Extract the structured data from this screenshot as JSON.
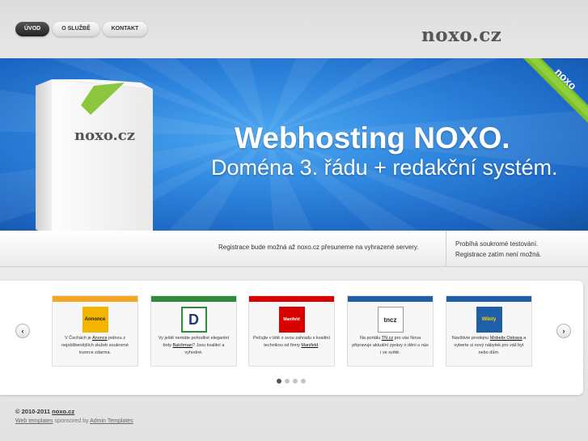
{
  "nav": {
    "items": [
      {
        "label": "ÚVOD",
        "active": true
      },
      {
        "label": "O SLUŽBĚ",
        "active": false
      },
      {
        "label": "KONTAKT",
        "active": false
      }
    ]
  },
  "logo": {
    "text": "noxo.cz"
  },
  "banner": {
    "headline": "Webhosting NOXO.",
    "subline": "Doména 3. řádu + redakční systém.",
    "box_label": "noxo.cz",
    "box_badge": "NOXO",
    "corner_badge": "noxo"
  },
  "info": {
    "left": "Registrace bude možná až noxo.cz přesuneme na vyhrazené servery.",
    "right_line1": "Probíhá soukromé testování.",
    "right_line2": "Registrace zatím není možná."
  },
  "carousel": {
    "prev_label": "‹",
    "next_label": "›",
    "cards": [
      {
        "color": "#f5a623",
        "thumb_label": "Annonce",
        "pre": "V Čechách je ",
        "link": "Anonce",
        "post": " jednou z nejoblíbenějších služeb soukromé inzerce zdarma."
      },
      {
        "color": "#2e8b3a",
        "thumb_label": "D",
        "pre": "Vy ještě nemáte pohodlné elegantní boty ",
        "link": "Balchman",
        "post": "? Jsou kvalitní a vyhodné."
      },
      {
        "color": "#d90000",
        "thumb_label": "Manifeld",
        "pre": "Pečujte v létě o svou zahradu s kvalitní technikou od firmy ",
        "link": "Manifeld",
        "post": "."
      },
      {
        "color": "#1e5fa8",
        "thumb_label": "tncz",
        "pre": "Na portálu ",
        "link": "TN.cz",
        "post": " pro vás Nova připravuje aktuální zprávy o dění u nás i ve světě."
      },
      {
        "color": "#1e5fa8",
        "thumb_label": "Wikity",
        "pre": "Navštivte prodejnu ",
        "link": "Mobelix Ostrava",
        "post": " a vyberte si nový nábytek pro váš byt nebo dům."
      }
    ],
    "dots": 4,
    "active_dot": 0
  },
  "footer": {
    "copyright": "© 2010-2011",
    "site": "noxo.cz",
    "line2_link1": "Web templates",
    "line2_mid": " sponsored by ",
    "line2_link2": "Admin Templates"
  }
}
